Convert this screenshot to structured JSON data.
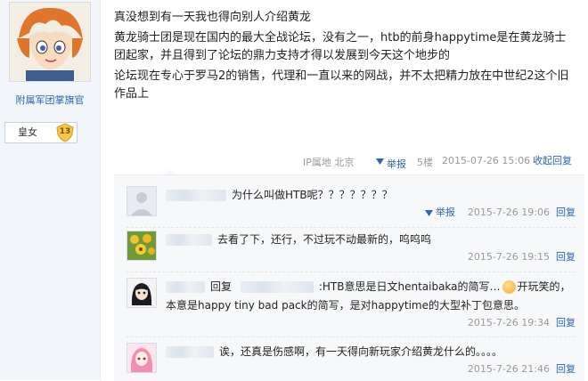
{
  "user": {
    "name": "附属军团掌旗官",
    "title": "皇女",
    "level": "13"
  },
  "post": {
    "lines": [
      "真没想到有一天我也得向别人介绍黄龙",
      "黄龙骑士团是现在国内的最大全战论坛，没有之一，htb的前身happytime是在黄龙骑士团起家，并且得到了论坛的鼎力支持才得以发展到今天这个地步的",
      "论坛现在专心于罗马2的销售，代理和一直以来的网战，并不太把精力放在中世纪2这个旧作品上"
    ],
    "ip": "IP属地 北京",
    "report": "举报",
    "floor": "5楼",
    "time": "2015-07-26 15:06",
    "reply_toggle": "收起回复"
  },
  "replies": [
    {
      "text": "为什么叫做HTB呢？？？？？？？",
      "report": "举报",
      "time": "2015-7-26 19:06",
      "reply": "回复"
    },
    {
      "text": "去看了下，还行，不过玩不动最新的，呜呜呜",
      "time": "2015-7-26 19:15",
      "reply": "回复"
    },
    {
      "prefix": "回复",
      "text": ":HTB意思是日文hentaibaka的简写…",
      "text2": "开玩笑的，本意是happy tiny bad pack的简写，是对happytime的大型补丁包意思。",
      "time": "2015-7-26 19:34",
      "reply": "回复"
    },
    {
      "text": "诶，还真是伤感啊，有一天得向新玩家介绍黄龙什么的。。。。",
      "time": "2015-7-26 21:46",
      "reply": "回复"
    }
  ],
  "colors": {
    "link": "#2d64b3",
    "meta": "#999999",
    "sidebar": "#f2f6fb"
  }
}
